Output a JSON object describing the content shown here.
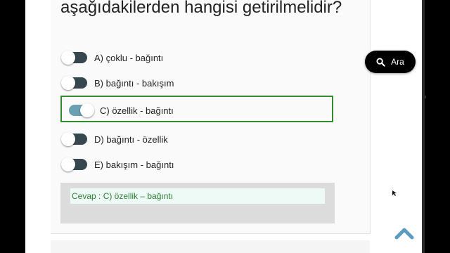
{
  "question": {
    "text": "aşağıdakilerden hangisi getirilmelidir?"
  },
  "options": [
    {
      "label": "A) çoklu - bağıntı",
      "selected": false
    },
    {
      "label": "B) bağıntı - bakışım",
      "selected": false
    },
    {
      "label": "C) özellik - bağıntı",
      "selected": true
    },
    {
      "label": "D) bağıntı - özellik",
      "selected": false
    },
    {
      "label": "E) bakışım - bağıntı",
      "selected": false
    }
  ],
  "answer": {
    "text": "Cevap : C) özellik – bağıntı"
  },
  "search": {
    "label": "Ara",
    "icon": "search-icon"
  },
  "scroll_top": {
    "icon": "chevron-up-icon"
  },
  "colors": {
    "selected_border": "#2e8b2e",
    "toggle_off": "#37474f",
    "toggle_on": "#6b9fb2",
    "answer_text": "#2e7d32"
  }
}
